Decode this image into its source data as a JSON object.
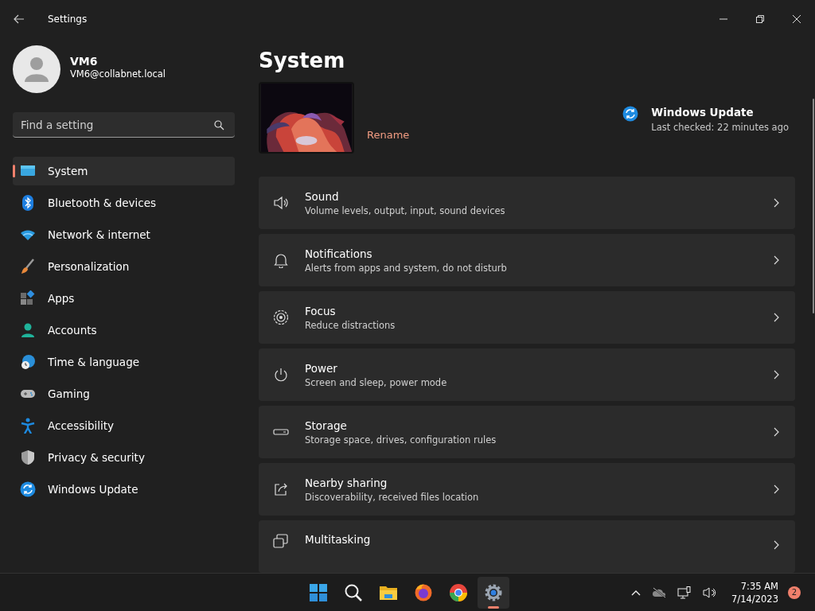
{
  "window": {
    "title": "Settings"
  },
  "account": {
    "name": "VM6",
    "email": "VM6@collabnet.local"
  },
  "search": {
    "placeholder": "Find a setting"
  },
  "nav": [
    {
      "label": "System",
      "selected": true
    },
    {
      "label": "Bluetooth & devices",
      "selected": false
    },
    {
      "label": "Network & internet",
      "selected": false
    },
    {
      "label": "Personalization",
      "selected": false
    },
    {
      "label": "Apps",
      "selected": false
    },
    {
      "label": "Accounts",
      "selected": false
    },
    {
      "label": "Time & language",
      "selected": false
    },
    {
      "label": "Gaming",
      "selected": false
    },
    {
      "label": "Accessibility",
      "selected": false
    },
    {
      "label": "Privacy & security",
      "selected": false
    },
    {
      "label": "Windows Update",
      "selected": false
    }
  ],
  "page": {
    "title": "System",
    "rename": "Rename",
    "update": {
      "title": "Windows Update",
      "status": "Last checked: 22 minutes ago"
    }
  },
  "cards": [
    {
      "title": "Sound",
      "subtitle": "Volume levels, output, input, sound devices"
    },
    {
      "title": "Notifications",
      "subtitle": "Alerts from apps and system, do not disturb"
    },
    {
      "title": "Focus",
      "subtitle": "Reduce distractions"
    },
    {
      "title": "Power",
      "subtitle": "Screen and sleep, power mode"
    },
    {
      "title": "Storage",
      "subtitle": "Storage space, drives, configuration rules"
    },
    {
      "title": "Nearby sharing",
      "subtitle": "Discoverability, received files location"
    },
    {
      "title": "Multitasking"
    }
  ],
  "taskbar": {
    "apps": [
      {
        "selected": false
      },
      {
        "selected": false
      },
      {
        "selected": false
      },
      {
        "selected": false
      },
      {
        "selected": false
      },
      {
        "selected": true
      }
    ],
    "clock": {
      "time": "7:35 AM",
      "date": "7/14/2023"
    },
    "notifications": "2"
  }
}
